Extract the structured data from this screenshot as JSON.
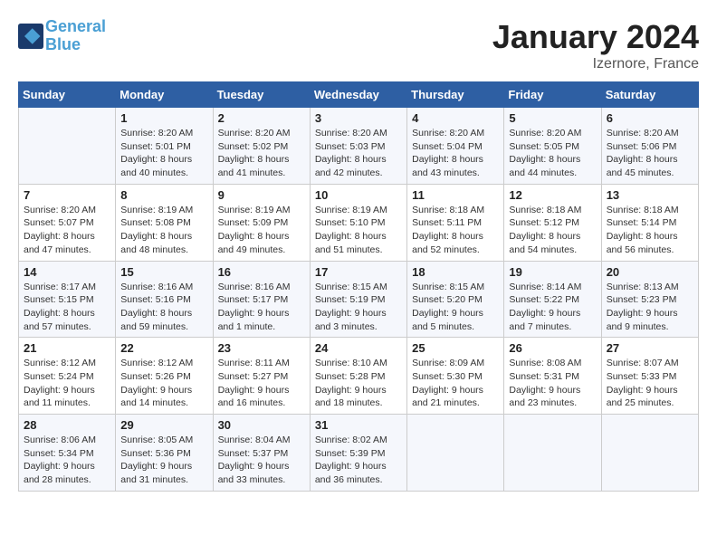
{
  "header": {
    "logo_line1": "General",
    "logo_line2": "Blue",
    "month": "January 2024",
    "location": "Izernore, France"
  },
  "columns": [
    "Sunday",
    "Monday",
    "Tuesday",
    "Wednesday",
    "Thursday",
    "Friday",
    "Saturday"
  ],
  "weeks": [
    [
      {
        "day": "",
        "sunrise": "",
        "sunset": "",
        "daylight": ""
      },
      {
        "day": "1",
        "sunrise": "Sunrise: 8:20 AM",
        "sunset": "Sunset: 5:01 PM",
        "daylight": "Daylight: 8 hours and 40 minutes."
      },
      {
        "day": "2",
        "sunrise": "Sunrise: 8:20 AM",
        "sunset": "Sunset: 5:02 PM",
        "daylight": "Daylight: 8 hours and 41 minutes."
      },
      {
        "day": "3",
        "sunrise": "Sunrise: 8:20 AM",
        "sunset": "Sunset: 5:03 PM",
        "daylight": "Daylight: 8 hours and 42 minutes."
      },
      {
        "day": "4",
        "sunrise": "Sunrise: 8:20 AM",
        "sunset": "Sunset: 5:04 PM",
        "daylight": "Daylight: 8 hours and 43 minutes."
      },
      {
        "day": "5",
        "sunrise": "Sunrise: 8:20 AM",
        "sunset": "Sunset: 5:05 PM",
        "daylight": "Daylight: 8 hours and 44 minutes."
      },
      {
        "day": "6",
        "sunrise": "Sunrise: 8:20 AM",
        "sunset": "Sunset: 5:06 PM",
        "daylight": "Daylight: 8 hours and 45 minutes."
      }
    ],
    [
      {
        "day": "7",
        "sunrise": "Sunrise: 8:20 AM",
        "sunset": "Sunset: 5:07 PM",
        "daylight": "Daylight: 8 hours and 47 minutes."
      },
      {
        "day": "8",
        "sunrise": "Sunrise: 8:19 AM",
        "sunset": "Sunset: 5:08 PM",
        "daylight": "Daylight: 8 hours and 48 minutes."
      },
      {
        "day": "9",
        "sunrise": "Sunrise: 8:19 AM",
        "sunset": "Sunset: 5:09 PM",
        "daylight": "Daylight: 8 hours and 49 minutes."
      },
      {
        "day": "10",
        "sunrise": "Sunrise: 8:19 AM",
        "sunset": "Sunset: 5:10 PM",
        "daylight": "Daylight: 8 hours and 51 minutes."
      },
      {
        "day": "11",
        "sunrise": "Sunrise: 8:18 AM",
        "sunset": "Sunset: 5:11 PM",
        "daylight": "Daylight: 8 hours and 52 minutes."
      },
      {
        "day": "12",
        "sunrise": "Sunrise: 8:18 AM",
        "sunset": "Sunset: 5:12 PM",
        "daylight": "Daylight: 8 hours and 54 minutes."
      },
      {
        "day": "13",
        "sunrise": "Sunrise: 8:18 AM",
        "sunset": "Sunset: 5:14 PM",
        "daylight": "Daylight: 8 hours and 56 minutes."
      }
    ],
    [
      {
        "day": "14",
        "sunrise": "Sunrise: 8:17 AM",
        "sunset": "Sunset: 5:15 PM",
        "daylight": "Daylight: 8 hours and 57 minutes."
      },
      {
        "day": "15",
        "sunrise": "Sunrise: 8:16 AM",
        "sunset": "Sunset: 5:16 PM",
        "daylight": "Daylight: 8 hours and 59 minutes."
      },
      {
        "day": "16",
        "sunrise": "Sunrise: 8:16 AM",
        "sunset": "Sunset: 5:17 PM",
        "daylight": "Daylight: 9 hours and 1 minute."
      },
      {
        "day": "17",
        "sunrise": "Sunrise: 8:15 AM",
        "sunset": "Sunset: 5:19 PM",
        "daylight": "Daylight: 9 hours and 3 minutes."
      },
      {
        "day": "18",
        "sunrise": "Sunrise: 8:15 AM",
        "sunset": "Sunset: 5:20 PM",
        "daylight": "Daylight: 9 hours and 5 minutes."
      },
      {
        "day": "19",
        "sunrise": "Sunrise: 8:14 AM",
        "sunset": "Sunset: 5:22 PM",
        "daylight": "Daylight: 9 hours and 7 minutes."
      },
      {
        "day": "20",
        "sunrise": "Sunrise: 8:13 AM",
        "sunset": "Sunset: 5:23 PM",
        "daylight": "Daylight: 9 hours and 9 minutes."
      }
    ],
    [
      {
        "day": "21",
        "sunrise": "Sunrise: 8:12 AM",
        "sunset": "Sunset: 5:24 PM",
        "daylight": "Daylight: 9 hours and 11 minutes."
      },
      {
        "day": "22",
        "sunrise": "Sunrise: 8:12 AM",
        "sunset": "Sunset: 5:26 PM",
        "daylight": "Daylight: 9 hours and 14 minutes."
      },
      {
        "day": "23",
        "sunrise": "Sunrise: 8:11 AM",
        "sunset": "Sunset: 5:27 PM",
        "daylight": "Daylight: 9 hours and 16 minutes."
      },
      {
        "day": "24",
        "sunrise": "Sunrise: 8:10 AM",
        "sunset": "Sunset: 5:28 PM",
        "daylight": "Daylight: 9 hours and 18 minutes."
      },
      {
        "day": "25",
        "sunrise": "Sunrise: 8:09 AM",
        "sunset": "Sunset: 5:30 PM",
        "daylight": "Daylight: 9 hours and 21 minutes."
      },
      {
        "day": "26",
        "sunrise": "Sunrise: 8:08 AM",
        "sunset": "Sunset: 5:31 PM",
        "daylight": "Daylight: 9 hours and 23 minutes."
      },
      {
        "day": "27",
        "sunrise": "Sunrise: 8:07 AM",
        "sunset": "Sunset: 5:33 PM",
        "daylight": "Daylight: 9 hours and 25 minutes."
      }
    ],
    [
      {
        "day": "28",
        "sunrise": "Sunrise: 8:06 AM",
        "sunset": "Sunset: 5:34 PM",
        "daylight": "Daylight: 9 hours and 28 minutes."
      },
      {
        "day": "29",
        "sunrise": "Sunrise: 8:05 AM",
        "sunset": "Sunset: 5:36 PM",
        "daylight": "Daylight: 9 hours and 31 minutes."
      },
      {
        "day": "30",
        "sunrise": "Sunrise: 8:04 AM",
        "sunset": "Sunset: 5:37 PM",
        "daylight": "Daylight: 9 hours and 33 minutes."
      },
      {
        "day": "31",
        "sunrise": "Sunrise: 8:02 AM",
        "sunset": "Sunset: 5:39 PM",
        "daylight": "Daylight: 9 hours and 36 minutes."
      },
      {
        "day": "",
        "sunrise": "",
        "sunset": "",
        "daylight": ""
      },
      {
        "day": "",
        "sunrise": "",
        "sunset": "",
        "daylight": ""
      },
      {
        "day": "",
        "sunrise": "",
        "sunset": "",
        "daylight": ""
      }
    ]
  ]
}
